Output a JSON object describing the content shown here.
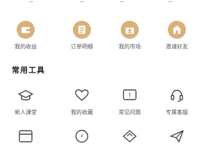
{
  "top_row": {
    "color": "#c94a4a",
    "labels": [
      "—",
      "—",
      "—",
      "—"
    ]
  },
  "quick_actions": {
    "icon_color": "#d9b07a",
    "items": [
      {
        "label": "我的收益",
        "icon": "wallet-icon"
      },
      {
        "label": "订单明细",
        "icon": "order-detail-icon"
      },
      {
        "label": "我的市场",
        "icon": "market-icon"
      },
      {
        "label": "邀请好友",
        "icon": "invite-house-icon"
      }
    ]
  },
  "tools": {
    "title": "常用工具",
    "items": [
      {
        "label": "新人课堂",
        "icon": "graduation-cap-icon"
      },
      {
        "label": "我的收藏",
        "icon": "heart-icon"
      },
      {
        "label": "常见问题",
        "icon": "question-icon"
      },
      {
        "label": "专属客服",
        "icon": "headset-icon"
      },
      {
        "label": "",
        "icon": "window-icon"
      },
      {
        "label": "",
        "icon": "compass-icon"
      },
      {
        "label": "",
        "icon": "diamond-icon"
      },
      {
        "label": "",
        "icon": "send-icon"
      }
    ]
  }
}
